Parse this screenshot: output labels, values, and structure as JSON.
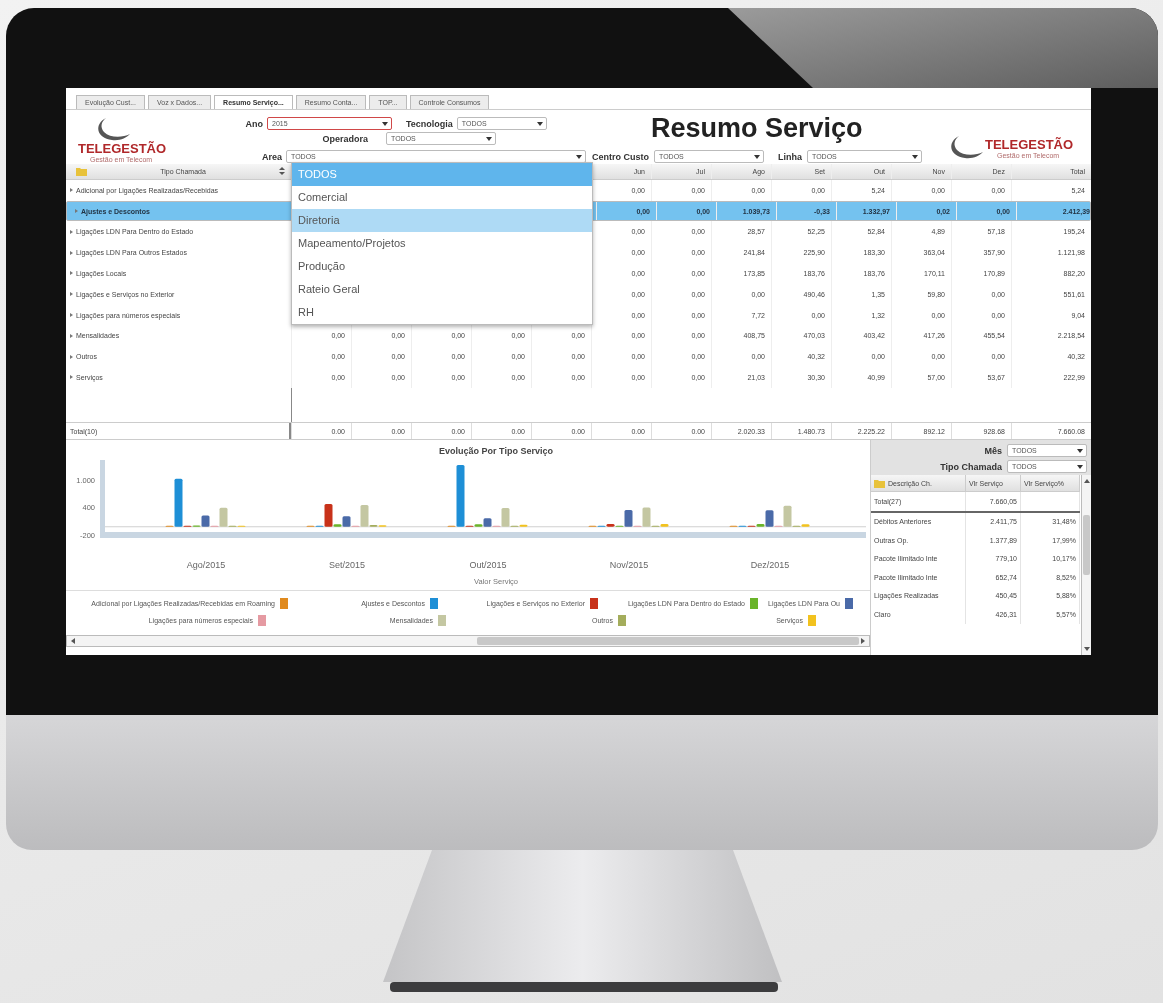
{
  "tabs": [
    {
      "label": "Evolução Cust...",
      "selected": false
    },
    {
      "label": "Voz x Dados...",
      "selected": false
    },
    {
      "label": "Resumo Serviço...",
      "selected": true
    },
    {
      "label": "Resumo Conta...",
      "selected": false
    },
    {
      "label": "TOP...",
      "selected": false
    },
    {
      "label": "Controle Consumos",
      "selected": false
    }
  ],
  "logos": [
    {
      "name": "TELEGESTÃO",
      "tagline": "Gestão em Telecom"
    },
    {
      "name": "TELEGESTÃO",
      "tagline": "Gestão em Telecom"
    }
  ],
  "title": "Resumo Serviço",
  "filters": [
    {
      "label": "Ano",
      "value": "2015",
      "focused": true
    },
    {
      "label": "Tecnologia",
      "value": "TODOS",
      "focused": false
    },
    {
      "label": "Operadora",
      "value": "TODOS",
      "focused": false
    },
    {
      "label": "Area",
      "value": "TODOS",
      "focused": false
    },
    {
      "label": "Centro Custo",
      "value": "TODOS",
      "focused": false
    },
    {
      "label": "Linha",
      "value": "TODOS",
      "focused": false
    }
  ],
  "dropdown": {
    "options": [
      {
        "label": "TODOS",
        "selected": true,
        "hovered": false
      },
      {
        "label": "Comercial",
        "selected": false,
        "hovered": false
      },
      {
        "label": "Diretoria",
        "selected": false,
        "hovered": true
      },
      {
        "label": "Mapeamento/Projetos",
        "selected": false,
        "hovered": false
      },
      {
        "label": "Produção",
        "selected": false,
        "hovered": false
      },
      {
        "label": "Rateio Geral",
        "selected": false,
        "hovered": false
      },
      {
        "label": "RH",
        "selected": false,
        "hovered": false
      }
    ]
  },
  "table": {
    "columns": [
      "Tipo Chamada",
      "",
      "",
      "",
      "",
      "",
      "Jun",
      "Jul",
      "Ago",
      "Set",
      "Out",
      "Nov",
      "Dez",
      "Total"
    ],
    "rows": [
      {
        "selected": false,
        "cells": [
          "Adicional por Ligações Realizadas/Recebidas",
          "",
          "",
          "",
          "",
          "",
          "0,00",
          "0,00",
          "0,00",
          "0,00",
          "5,24",
          "0,00",
          "0,00",
          "5,24"
        ]
      },
      {
        "selected": true,
        "cells": [
          "Ajustes e Descontos",
          "",
          "",
          "",
          "",
          "",
          "0,00",
          "0,00",
          "1.039,73",
          "-0,33",
          "1.332,97",
          "0,02",
          "0,00",
          "2.412,39"
        ]
      },
      {
        "selected": false,
        "cells": [
          "Ligações LDN Para Dentro do Estado",
          "",
          "",
          "",
          "",
          "",
          "0,00",
          "0,00",
          "28,57",
          "52,25",
          "52,84",
          "4,89",
          "57,18",
          "195,24"
        ]
      },
      {
        "selected": false,
        "cells": [
          "Ligações LDN Para Outros Estados",
          "",
          "",
          "",
          "",
          "",
          "0,00",
          "0,00",
          "241,84",
          "225,90",
          "183,30",
          "363,04",
          "357,90",
          "1.121,98"
        ]
      },
      {
        "selected": false,
        "cells": [
          "Ligações Locais",
          "",
          "",
          "",
          "",
          "",
          "0,00",
          "0,00",
          "173,85",
          "183,76",
          "183,76",
          "170,11",
          "170,89",
          "882,20"
        ]
      },
      {
        "selected": false,
        "cells": [
          "Ligações e Serviços no Exterior",
          "",
          "",
          "",
          "",
          "",
          "0,00",
          "0,00",
          "0,00",
          "490,46",
          "1,35",
          "59,80",
          "0,00",
          "551,61"
        ]
      },
      {
        "selected": false,
        "cells": [
          "Ligações para números especiais",
          "",
          "",
          "",
          "",
          "",
          "0,00",
          "0,00",
          "7,72",
          "0,00",
          "1,32",
          "0,00",
          "0,00",
          "9,04"
        ]
      },
      {
        "selected": false,
        "cells": [
          "Mensalidades",
          "0,00",
          "0,00",
          "0,00",
          "0,00",
          "0,00",
          "0,00",
          "0,00",
          "408,75",
          "470,03",
          "403,42",
          "417,26",
          "455,54",
          "2.218,54"
        ]
      },
      {
        "selected": false,
        "cells": [
          "Outros",
          "0,00",
          "0,00",
          "0,00",
          "0,00",
          "0,00",
          "0,00",
          "0,00",
          "0,00",
          "40,32",
          "0,00",
          "0,00",
          "0,00",
          "40,32"
        ]
      },
      {
        "selected": false,
        "cells": [
          "Serviços",
          "0,00",
          "0,00",
          "0,00",
          "0,00",
          "0,00",
          "0,00",
          "0,00",
          "21,03",
          "30,30",
          "40,99",
          "57,00",
          "53,67",
          "222,99"
        ]
      }
    ],
    "total_row": {
      "cells": [
        "Total(10)",
        "0.00",
        "0.00",
        "0.00",
        "0.00",
        "0.00",
        "0.00",
        "0.00",
        "2.020.33",
        "1.480.73",
        "2.225.22",
        "892.12",
        "928.68",
        "7.660.08"
      ]
    }
  },
  "chart": {
    "chart_data": {
      "type": "bar",
      "title": "Evolução Por Tipo Serviço",
      "xlabel": "Valor Serviço",
      "categories": [
        "Ago/2015",
        "Set/2015",
        "Out/2015",
        "Nov/2015",
        "Dez/2015"
      ],
      "ylim": [
        -200,
        1400
      ],
      "yticks": [
        {
          "value": 1000,
          "label": "1.000"
        },
        {
          "value": 400,
          "label": "400"
        },
        {
          "value": -200,
          "label": "-200"
        }
      ],
      "series": [
        {
          "name": "Adicional por Ligações Realizadas/Recebidas em Roaming",
          "color": "#e08a1e",
          "values": [
            0,
            0,
            5,
            0,
            0
          ]
        },
        {
          "name": "Ajustes e Descontos",
          "color": "#1e8fd6",
          "values": [
            1040,
            0,
            1333,
            0,
            0
          ]
        },
        {
          "name": "Ligações e Serviços no Exterior",
          "color": "#c8321a",
          "values": [
            0,
            490,
            1,
            60,
            0
          ]
        },
        {
          "name": "Ligações LDN Para Dentro do Estado",
          "color": "#6ab42a",
          "values": [
            29,
            52,
            53,
            5,
            57
          ]
        },
        {
          "name": "Ligações LDN Para Ou",
          "color": "#4a6aa8",
          "values": [
            242,
            226,
            183,
            363,
            358
          ]
        },
        {
          "name": "Ligações para números especiais",
          "color": "#e59aa2",
          "values": [
            8,
            0,
            1,
            0,
            0
          ]
        },
        {
          "name": "Mensalidades",
          "color": "#c4c7a2",
          "values": [
            409,
            470,
            403,
            417,
            456
          ]
        },
        {
          "name": "Outros",
          "color": "#a4ad5c",
          "values": [
            0,
            40,
            0,
            0,
            0
          ]
        },
        {
          "name": "Serviços",
          "color": "#f2c21e",
          "values": [
            21,
            30,
            41,
            57,
            54
          ]
        }
      ]
    }
  },
  "side_panel": {
    "filters": [
      {
        "label": "Mês",
        "value": "TODOS"
      },
      {
        "label": "Tipo Chamada",
        "value": "TODOS"
      }
    ],
    "columns": [
      "Descrição Ch.",
      "Vlr Serviço",
      "Vlr Serviço%"
    ],
    "total": {
      "label": "Total(27)",
      "value": "7.660,05"
    },
    "rows": [
      [
        "Débitos Anteriores",
        "2.411,75",
        "31,48%"
      ],
      [
        "Outras Op.",
        "1.377,89",
        "17,99%"
      ],
      [
        "Pacote Ilimitado Inte",
        "779,10",
        "10,17%"
      ],
      [
        "Pacote Ilimitado Inte",
        "652,74",
        "8,52%"
      ],
      [
        "Ligações Realizadas",
        "450,45",
        "5,88%"
      ],
      [
        "Claro",
        "426,31",
        "5,57%"
      ]
    ]
  }
}
